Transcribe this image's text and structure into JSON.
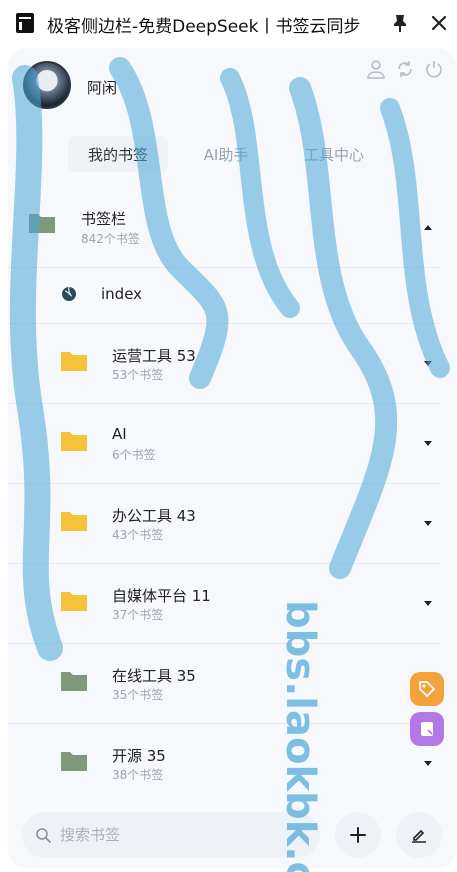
{
  "window": {
    "title": "极客侧边栏-免费DeepSeek丨书签云同步"
  },
  "user": {
    "name": "阿闲"
  },
  "tabs": [
    {
      "label": "我的书签"
    },
    {
      "label": "AI助手"
    },
    {
      "label": "工具中心"
    }
  ],
  "root_folder": {
    "title": "书签栏",
    "count": "842个书签"
  },
  "link_item": {
    "title": "index"
  },
  "folders": [
    {
      "title": "运营工具 53",
      "count": "53个书签"
    },
    {
      "title": "AI",
      "count": "6个书签"
    },
    {
      "title": "办公工具 43",
      "count": "43个书签"
    },
    {
      "title": "自媒体平台 11",
      "count": "37个书签"
    },
    {
      "title": "在线工具 35",
      "count": "35个书签"
    },
    {
      "title": "开源 35",
      "count": "38个书签"
    }
  ],
  "search": {
    "placeholder": "搜索书签"
  },
  "watermark": {
    "text": "bbs.laokbk.cn"
  },
  "colors": {
    "accent_folder": "#f4c43a",
    "muted_folder": "#7f9a7a",
    "fab_orange": "#f5a13c",
    "fab_purple": "#b178e6",
    "watermark": "#4aa8d8"
  }
}
